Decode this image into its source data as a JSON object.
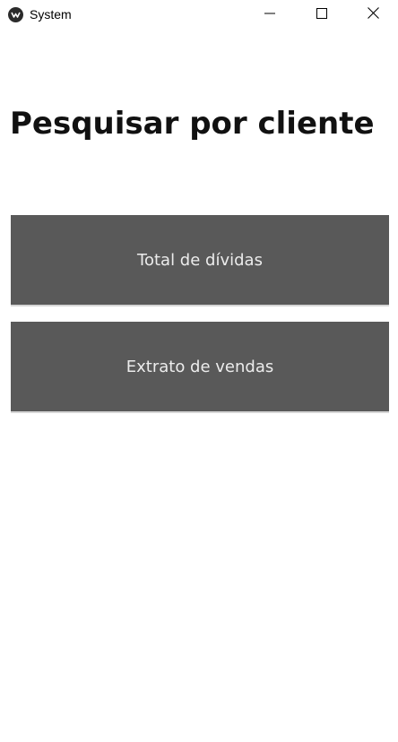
{
  "window": {
    "title": "System",
    "icon": "kivy-logo-icon",
    "controls": [
      "minimize-icon",
      "maximize-icon",
      "close-icon"
    ]
  },
  "main": {
    "heading": "Pesquisar por cliente",
    "buttons": [
      {
        "label": "Total de dívidas"
      },
      {
        "label": "Extrato de vendas"
      }
    ]
  },
  "colors": {
    "button_bg": "#595959",
    "button_text": "#ececec",
    "heading_text": "#111111",
    "background": "#ffffff"
  }
}
